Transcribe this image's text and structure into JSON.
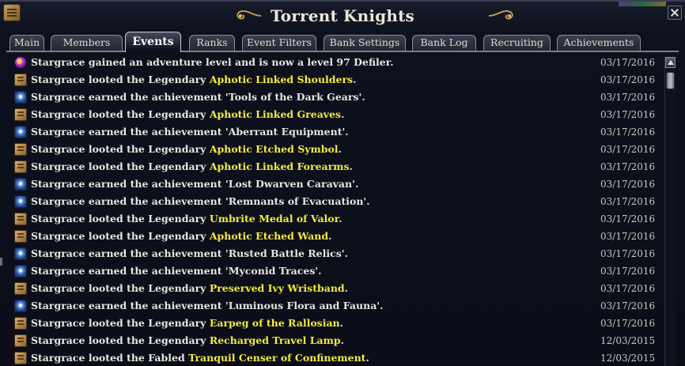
{
  "window": {
    "title": "Torrent Knights"
  },
  "tabs": [
    {
      "label": "Main"
    },
    {
      "label": "Members"
    },
    {
      "label": "Events",
      "active": true
    },
    {
      "label": "Ranks"
    },
    {
      "label": "Event Filters"
    },
    {
      "label": "Bank Settings"
    },
    {
      "label": "Bank Log"
    },
    {
      "label": "Recruiting"
    },
    {
      "label": "Achievements"
    }
  ],
  "colors": {
    "highlight_item": "#f5ea3a",
    "event_text": "#e8e6de",
    "background": "#0b0e18"
  },
  "events": [
    {
      "icon": "level-up-icon",
      "text": "Stargrace gained an adventure level and is now a level 97 Defiler.",
      "highlight": "",
      "suffix": "",
      "date": "03/17/2016"
    },
    {
      "icon": "loot-icon",
      "text": "Stargrace looted the Legendary ",
      "highlight": "Aphotic Linked Shoulders",
      "suffix": ".",
      "date": "03/17/2016"
    },
    {
      "icon": "achievement-icon",
      "text": "Stargrace earned the achievement 'Tools of the Dark Gears'.",
      "highlight": "",
      "suffix": "",
      "date": "03/17/2016"
    },
    {
      "icon": "loot-icon",
      "text": "Stargrace looted the Legendary ",
      "highlight": "Aphotic Linked Greaves",
      "suffix": ".",
      "date": "03/17/2016"
    },
    {
      "icon": "achievement-icon",
      "text": "Stargrace earned the achievement 'Aberrant Equipment'.",
      "highlight": "",
      "suffix": "",
      "date": "03/17/2016"
    },
    {
      "icon": "loot-icon",
      "text": "Stargrace looted the Legendary ",
      "highlight": "Aphotic Etched Symbol",
      "suffix": ".",
      "date": "03/17/2016"
    },
    {
      "icon": "loot-icon",
      "text": "Stargrace looted the Legendary ",
      "highlight": "Aphotic Linked Forearms",
      "suffix": ".",
      "date": "03/17/2016"
    },
    {
      "icon": "achievement-icon",
      "text": "Stargrace earned the achievement 'Lost Dwarven Caravan'.",
      "highlight": "",
      "suffix": "",
      "date": "03/17/2016"
    },
    {
      "icon": "achievement-icon",
      "text": "Stargrace earned the achievement 'Remnants of Evacuation'.",
      "highlight": "",
      "suffix": "",
      "date": "03/17/2016"
    },
    {
      "icon": "loot-icon",
      "text": "Stargrace looted the Legendary ",
      "highlight": "Umbrite Medal of Valor",
      "suffix": ".",
      "date": "03/17/2016"
    },
    {
      "icon": "loot-icon",
      "text": "Stargrace looted the Legendary ",
      "highlight": "Aphotic Etched Wand",
      "suffix": ".",
      "date": "03/17/2016"
    },
    {
      "icon": "achievement-icon",
      "text": "Stargrace earned the achievement 'Rusted Battle Relics'.",
      "highlight": "",
      "suffix": "",
      "date": "03/17/2016"
    },
    {
      "icon": "achievement-icon",
      "text": "Stargrace earned the achievement 'Myconid Traces'.",
      "highlight": "",
      "suffix": "",
      "date": "03/17/2016"
    },
    {
      "icon": "loot-icon",
      "text": "Stargrace looted the Legendary ",
      "highlight": "Preserved Ivy Wristband",
      "suffix": ".",
      "date": "03/17/2016"
    },
    {
      "icon": "achievement-icon",
      "text": "Stargrace earned the achievement 'Luminous Flora and Fauna'.",
      "highlight": "",
      "suffix": "",
      "date": "03/17/2016"
    },
    {
      "icon": "loot-icon",
      "text": "Stargrace looted the Legendary ",
      "highlight": "Earpeg of the Rallosian",
      "suffix": ".",
      "date": "03/17/2016"
    },
    {
      "icon": "loot-icon",
      "text": "Stargrace looted the Legendary ",
      "highlight": "Recharged Travel Lamp",
      "suffix": ".",
      "date": "12/03/2015"
    },
    {
      "icon": "loot-icon",
      "text": "Stargrace looted the Fabled ",
      "highlight": "Tranquil Censer of Confinement",
      "suffix": ".",
      "date": "12/03/2015"
    }
  ]
}
